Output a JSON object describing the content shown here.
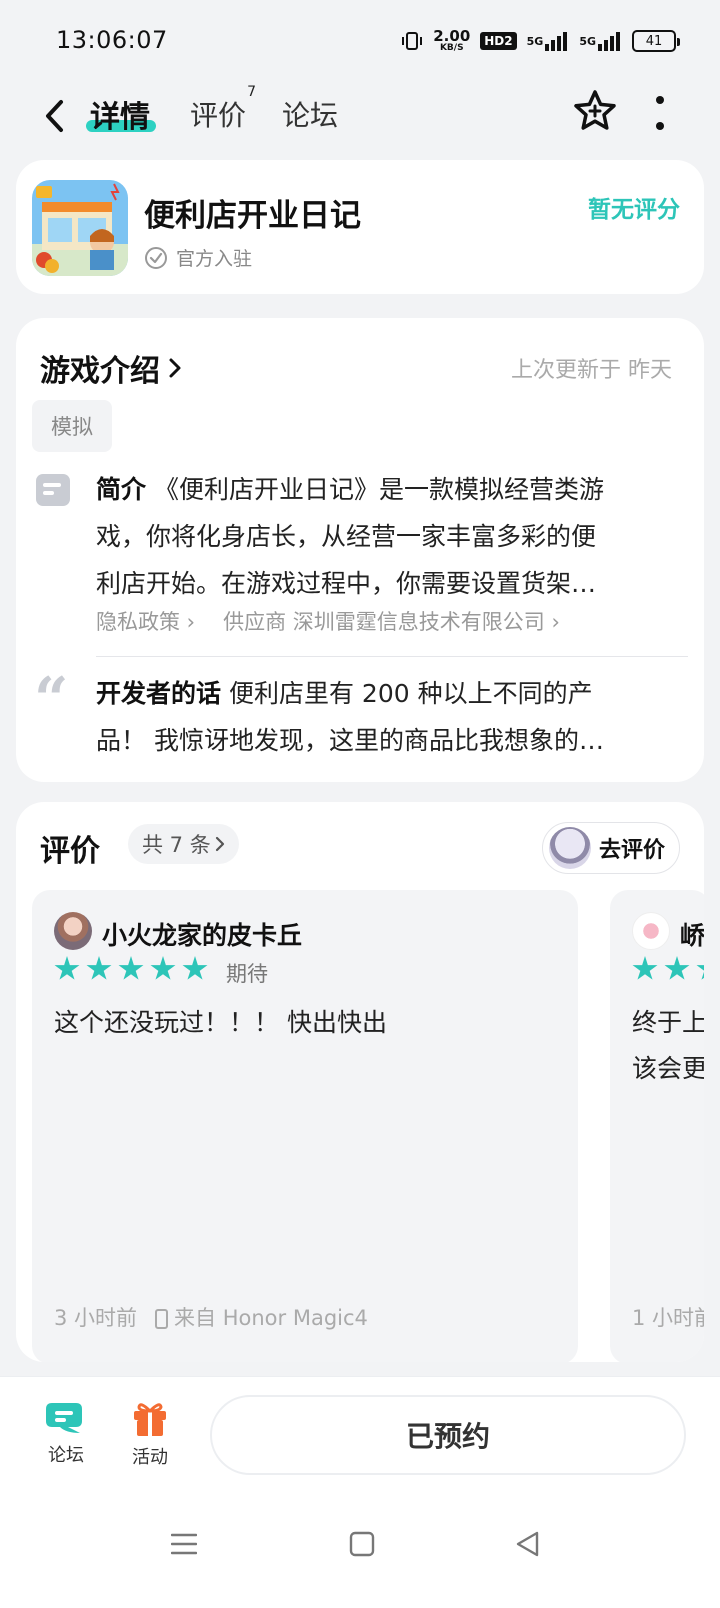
{
  "status_bar": {
    "time": "13:06:07",
    "net_speed_value": "2.00",
    "net_speed_unit": "KB/S",
    "hd_badge": "HD2",
    "signal1": "5G",
    "signal2": "5G",
    "battery": "41"
  },
  "nav": {
    "tabs": [
      {
        "label": "详情",
        "active": true
      },
      {
        "label": "评价",
        "badge": "7"
      },
      {
        "label": "论坛"
      }
    ]
  },
  "app": {
    "title": "便利店开业日记",
    "official_label": "官方入驻",
    "rating_text": "暂无评分"
  },
  "intro": {
    "title": "游戏介绍",
    "updated": "上次更新于 昨天",
    "genre_tag": "模拟",
    "desc_label": "简介",
    "desc_line1": " 《便利店开业日记》是一款模拟经营类游",
    "desc_line2": "戏，你将化身店长，从经营一家丰富多彩的便",
    "desc_line3": "利店开始。在游戏过程中，你需要设置货架…",
    "privacy_link": "隐私政策",
    "supplier_link": "供应商 深圳雷霆信息技术有限公司",
    "dev_label": "开发者的话",
    "dev_line1": " 便利店里有 200 种以上不同的产",
    "dev_line2": "品！ 我惊讶地发现，这里的商品比我想象的…"
  },
  "reviews": {
    "title": "评价",
    "count_label": "共 7 条",
    "write_label": "去评价",
    "items": [
      {
        "name": "小火龙家的皮卡丘",
        "stars": 5,
        "tag": "期待",
        "text": "这个还没玩过！！！ 快出快出",
        "time": "3 小时前",
        "device": "来自 Honor Magic4"
      },
      {
        "name": "峤",
        "text_line1": "终于上",
        "text_line2": "该会更",
        "time": "1 小时前"
      }
    ]
  },
  "bottom_bar": {
    "forum_label": "论坛",
    "activity_label": "活动",
    "reserve_label": "已预约"
  },
  "colors": {
    "accent": "#2dc5b8",
    "activity_icon": "#f36c32"
  }
}
